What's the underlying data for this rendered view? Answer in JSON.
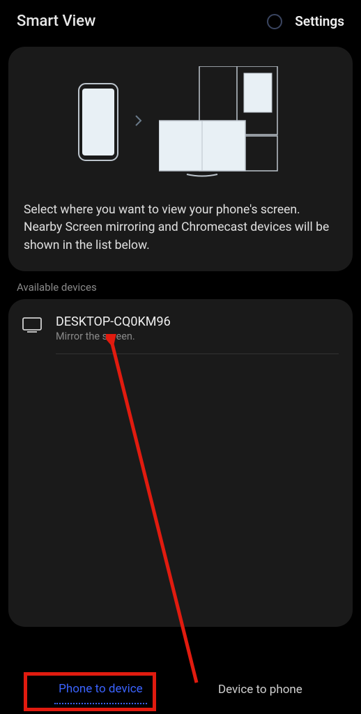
{
  "header": {
    "title": "Smart View",
    "settings_label": "Settings"
  },
  "card": {
    "description": "Select where you want to view your phone's screen. Nearby Screen mirroring and Chromecast devices will be shown in the list below."
  },
  "section": {
    "available_label": "Available devices"
  },
  "device": {
    "name": "DESKTOP-CQ0KM96",
    "subtitle": "Mirror the screen."
  },
  "tabs": {
    "phone_to_device": "Phone to device",
    "device_to_phone": "Device to phone"
  },
  "colors": {
    "accent": "#3b63ff",
    "annotation": "#e11b0f"
  }
}
